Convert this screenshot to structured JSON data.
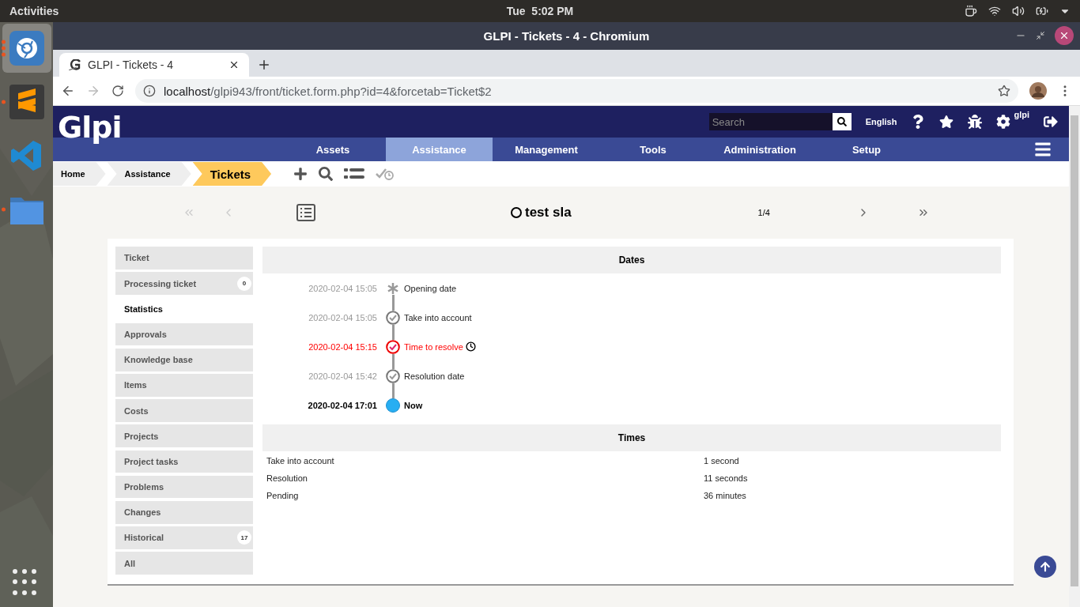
{
  "desktop": {
    "activities": "Activities",
    "clock": "Tue  5:02 PM"
  },
  "dock": [
    {
      "kind": "chromium",
      "running": true,
      "selected": true
    },
    {
      "kind": "sublime",
      "running": true,
      "selected": false
    },
    {
      "kind": "vscode",
      "running": false,
      "selected": false
    },
    {
      "kind": "files",
      "running": true,
      "selected": false
    }
  ],
  "browser": {
    "window_title": "GLPI - Tickets - 4 - Chromium",
    "tab_title": "GLPI - Tickets - 4",
    "url_host": "localhost",
    "url_path": "/glpi943/front/ticket.form.php?id=4&forcetab=Ticket$2"
  },
  "header": {
    "logo": "Glpi",
    "search": {
      "placeholder": "Search"
    },
    "language": "English",
    "user": "glpi"
  },
  "menu": [
    {
      "label": "Assets",
      "selected": false
    },
    {
      "label": "Assistance",
      "selected": true
    },
    {
      "label": "Management",
      "selected": false
    },
    {
      "label": "Tools",
      "selected": false
    },
    {
      "label": "Administration",
      "selected": false
    },
    {
      "label": "Setup",
      "selected": false
    }
  ],
  "breadcrumbs": [
    {
      "label": "Home",
      "current": false
    },
    {
      "label": "Assistance",
      "current": false
    },
    {
      "label": "Tickets",
      "current": true
    }
  ],
  "record_nav": {
    "title": "test sla",
    "counter": "1/4",
    "first_disabled": true,
    "prev_disabled": true,
    "next_disabled": false,
    "last_disabled": false
  },
  "tabs": [
    {
      "label": "Ticket",
      "selected": false
    },
    {
      "label": "Processing ticket",
      "selected": false,
      "count": "0"
    },
    {
      "label": "Statistics",
      "selected": true
    },
    {
      "label": "Approvals",
      "selected": false
    },
    {
      "label": "Knowledge base",
      "selected": false
    },
    {
      "label": "Items",
      "selected": false
    },
    {
      "label": "Costs",
      "selected": false
    },
    {
      "label": "Projects",
      "selected": false
    },
    {
      "label": "Project tasks",
      "selected": false
    },
    {
      "label": "Problems",
      "selected": false
    },
    {
      "label": "Changes",
      "selected": false
    },
    {
      "label": "Historical",
      "selected": false,
      "count": "17"
    },
    {
      "label": "All",
      "selected": false
    }
  ],
  "dates": {
    "title": "Dates",
    "items": [
      {
        "date": "2020-02-04 15:05",
        "label": "Opening date",
        "kind": "opening"
      },
      {
        "date": "2020-02-04 15:05",
        "label": "Take into account",
        "kind": "done"
      },
      {
        "date": "2020-02-04 15:15",
        "label": "Time to resolve",
        "kind": "late"
      },
      {
        "date": "2020-02-04 15:42",
        "label": "Resolution date",
        "kind": "done"
      },
      {
        "date": "2020-02-04 17:01",
        "label": "Now",
        "kind": "now"
      }
    ]
  },
  "times": {
    "title": "Times",
    "rows": [
      {
        "label": "Take into account",
        "value": "1 second"
      },
      {
        "label": "Resolution",
        "value": "11 seconds"
      },
      {
        "label": "Pending",
        "value": "36 minutes"
      }
    ]
  }
}
